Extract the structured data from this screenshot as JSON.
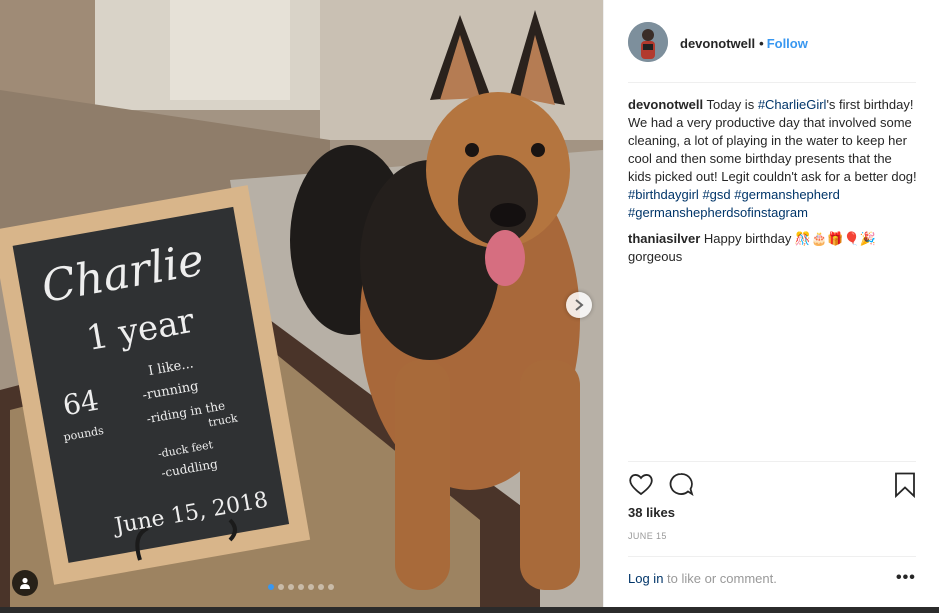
{
  "post": {
    "author": "devonotwell",
    "follow_label": "Follow",
    "separator": "•",
    "likes": "38 likes",
    "date": "JUNE 15",
    "login_link": "Log in",
    "login_suffix": " to like or comment.",
    "more_icon": "•••"
  },
  "caption": {
    "user": "devonotwell",
    "text_1": " Today is ",
    "hashtag_1": "#CharlieGirl",
    "text_2": "'s first birthday! We had a very productive day that involved some cleaning, a lot of playing in the water to keep her cool and then some birthday presents that the kids picked out! Legit couldn't ask for a better dog! ",
    "hashtag_2": "#birthdaygirl",
    "hashtag_3": "#gsd",
    "hashtag_4": "#germanshepherd",
    "hashtag_5": "#germanshepherdsofinstagram"
  },
  "comment": {
    "user": "thaniasilver",
    "text": " Happy birthday 🎊🎂🎁🎈🎉 gorgeous"
  },
  "photo_sign": {
    "name": "Charlie",
    "age": "1 year",
    "weight_num": "64",
    "weight_unit": "pounds",
    "likes_title": "I like...",
    "like_1": "-running",
    "like_2": "-riding in the",
    "like_2b": "truck",
    "like_3": "-duck feet",
    "like_4": "-cuddling",
    "date": "June 15, 2018"
  },
  "carousel": {
    "dots": 7,
    "active": 0
  },
  "colors": {
    "link": "#3897f0",
    "hashtag": "#003569",
    "muted": "#999999"
  },
  "icons": [
    "heart-icon",
    "comment-icon",
    "bookmark-icon",
    "chevron-right-icon",
    "user-tag-icon"
  ]
}
